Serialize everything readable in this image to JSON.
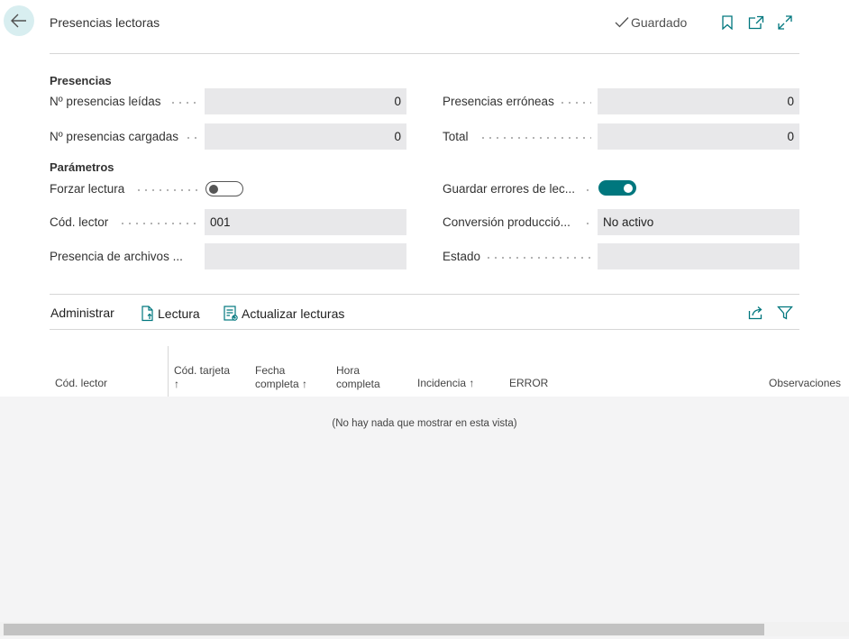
{
  "header": {
    "title": "Presencias lectoras",
    "saved_status": "Guardado"
  },
  "presencias": {
    "section_title": "Presencias",
    "leidas_label": "Nº presencias leídas",
    "leidas_value": "0",
    "cargadas_label": "Nº presencias cargadas",
    "cargadas_value": "0",
    "erroneas_label": "Presencias erróneas",
    "erroneas_value": "0",
    "total_label": "Total",
    "total_value": "0"
  },
  "parametros": {
    "section_title": "Parámetros",
    "forzar_label": "Forzar lectura",
    "forzar_on": false,
    "guardar_label": "Guardar errores de lec...",
    "guardar_on": true,
    "cod_lector_label": "Cód. lector",
    "cod_lector_value": "001",
    "conversion_label": "Conversión producció...",
    "conversion_value": "No activo",
    "archivos_label": "Presencia de archivos ...",
    "archivos_value": "",
    "estado_label": "Estado",
    "estado_value": ""
  },
  "actions": {
    "administrar": "Administrar",
    "lectura": "Lectura",
    "actualizar": "Actualizar lecturas"
  },
  "table": {
    "columns": [
      {
        "line1": "Cód. lector",
        "line2": ""
      },
      {
        "line1": "Cód. tarjeta",
        "line2": "↑"
      },
      {
        "line1": "Fecha",
        "line2": "completa ↑"
      },
      {
        "line1": "Hora",
        "line2": "completa"
      },
      {
        "line1": "Incidencia ↑",
        "line2": ""
      },
      {
        "line1": "ERROR",
        "line2": ""
      },
      {
        "line1": "Observaciones",
        "line2": ""
      }
    ],
    "empty_message": "(No hay nada que mostrar en esta vista)"
  },
  "colors": {
    "accent": "#00777e",
    "field_bg": "#e8e8ea",
    "grid_bg": "#f4f4f5"
  }
}
